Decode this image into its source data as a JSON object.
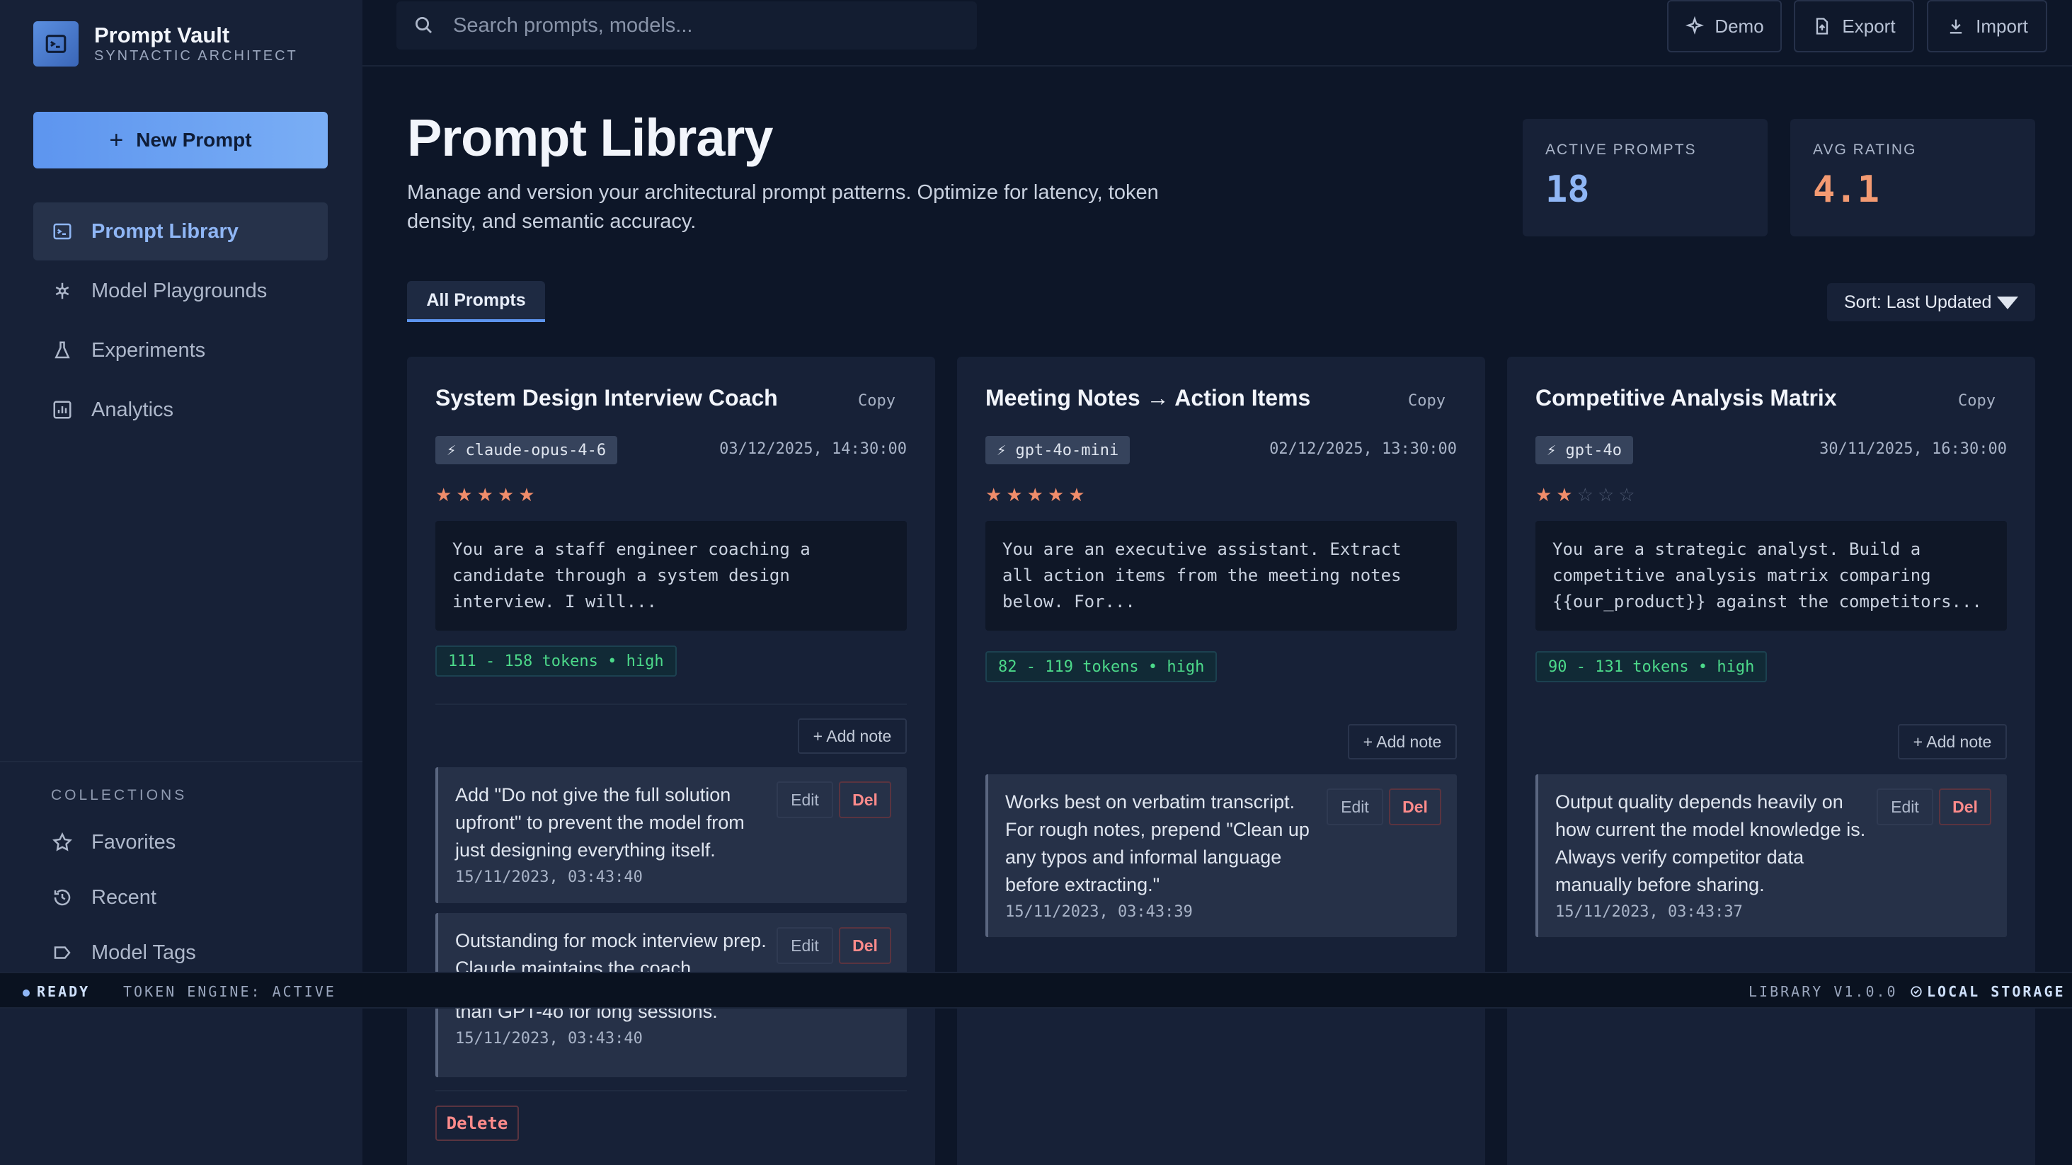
{
  "brand": {
    "title": "Prompt Vault",
    "subtitle": "SYNTACTIC ARCHITECT"
  },
  "sidebar": {
    "new_prompt_label": "New Prompt",
    "nav": [
      {
        "label": "Prompt Library",
        "icon": "terminal-icon",
        "active": true
      },
      {
        "label": "Model Playgrounds",
        "icon": "network-icon"
      },
      {
        "label": "Experiments",
        "icon": "flask-icon"
      },
      {
        "label": "Analytics",
        "icon": "chart-icon"
      }
    ],
    "collections_title": "COLLECTIONS",
    "collections": [
      {
        "label": "Favorites",
        "icon": "star-icon"
      },
      {
        "label": "Recent",
        "icon": "history-icon"
      },
      {
        "label": "Model Tags",
        "icon": "tag-icon"
      }
    ]
  },
  "topbar": {
    "search_placeholder": "Search prompts, models...",
    "demo_label": "Demo",
    "export_label": "Export",
    "import_label": "Import"
  },
  "header": {
    "title": "Prompt Library",
    "description": "Manage and version your architectural prompt patterns. Optimize for latency, token density, and semantic accuracy.",
    "stats": [
      {
        "label": "ACTIVE PROMPTS",
        "value": "18",
        "color": "#8fb6f5"
      },
      {
        "label": "AVG RATING",
        "value": "4.1",
        "color": "#f39a72"
      }
    ]
  },
  "filters": {
    "tab_all": "All Prompts",
    "sort_label": "Sort: Last Updated"
  },
  "cards": [
    {
      "title": "System Design Interview Coach",
      "copy_label": "Copy",
      "model": "⚡ claude-opus-4-6",
      "date": "03/12/2025, 14:30:00",
      "rating": 5,
      "prompt": "You are a staff engineer coaching a candidate through a system design interview. I will...",
      "tokens": "111 - 158 tokens • high",
      "add_note_label": "+ Add note",
      "notes": [
        {
          "text": "Add \"Do not give the full solution upfront\" to prevent the model from just designing everything itself.",
          "date": "15/11/2023, 03:43:40",
          "edit": "Edit",
          "del": "Del"
        },
        {
          "text": "Outstanding for mock interview prep. Claude maintains the coach",
          "text2": "than GPT-4o for long sessions.",
          "date": "15/11/2023, 03:43:40",
          "edit": "Edit",
          "del": "Del"
        }
      ],
      "delete_label": "Delete"
    },
    {
      "title": "Meeting Notes → Action Items",
      "copy_label": "Copy",
      "model": "⚡ gpt-4o-mini",
      "date": "02/12/2025, 13:30:00",
      "rating": 5,
      "prompt": "You are an executive assistant. Extract all action items from the meeting notes below. For...",
      "tokens": "82 - 119 tokens • high",
      "add_note_label": "+ Add note",
      "notes": [
        {
          "text": "Works best on verbatim transcript. For rough notes, prepend \"Clean up any typos and informal language before extracting.\"",
          "date": "15/11/2023, 03:43:39",
          "edit": "Edit",
          "del": "Del"
        }
      ]
    },
    {
      "title": "Competitive Analysis Matrix",
      "copy_label": "Copy",
      "model": "⚡ gpt-4o",
      "date": "30/11/2025, 16:30:00",
      "rating": 2,
      "prompt": "You are a strategic analyst. Build a competitive analysis matrix comparing {{our_product}} against the competitors...",
      "tokens": "90 - 131 tokens • high",
      "add_note_label": "+ Add note",
      "notes": [
        {
          "text": "Output quality depends heavily on how current the model knowledge is. Always verify competitor data manually before sharing.",
          "date": "15/11/2023, 03:43:37",
          "edit": "Edit",
          "del": "Del"
        }
      ]
    }
  ],
  "statusbar": {
    "ready": "READY",
    "engine": "TOKEN ENGINE: ACTIVE",
    "version": "LIBRARY V1.0.0",
    "storage": "LOCAL STORAGE"
  },
  "colors": {
    "accent": "#5d95ef",
    "background": "#0d1628",
    "panel": "#172137",
    "star": "#f08c6a",
    "token_green": "#4cd98a",
    "danger": "#ff8b8b"
  }
}
